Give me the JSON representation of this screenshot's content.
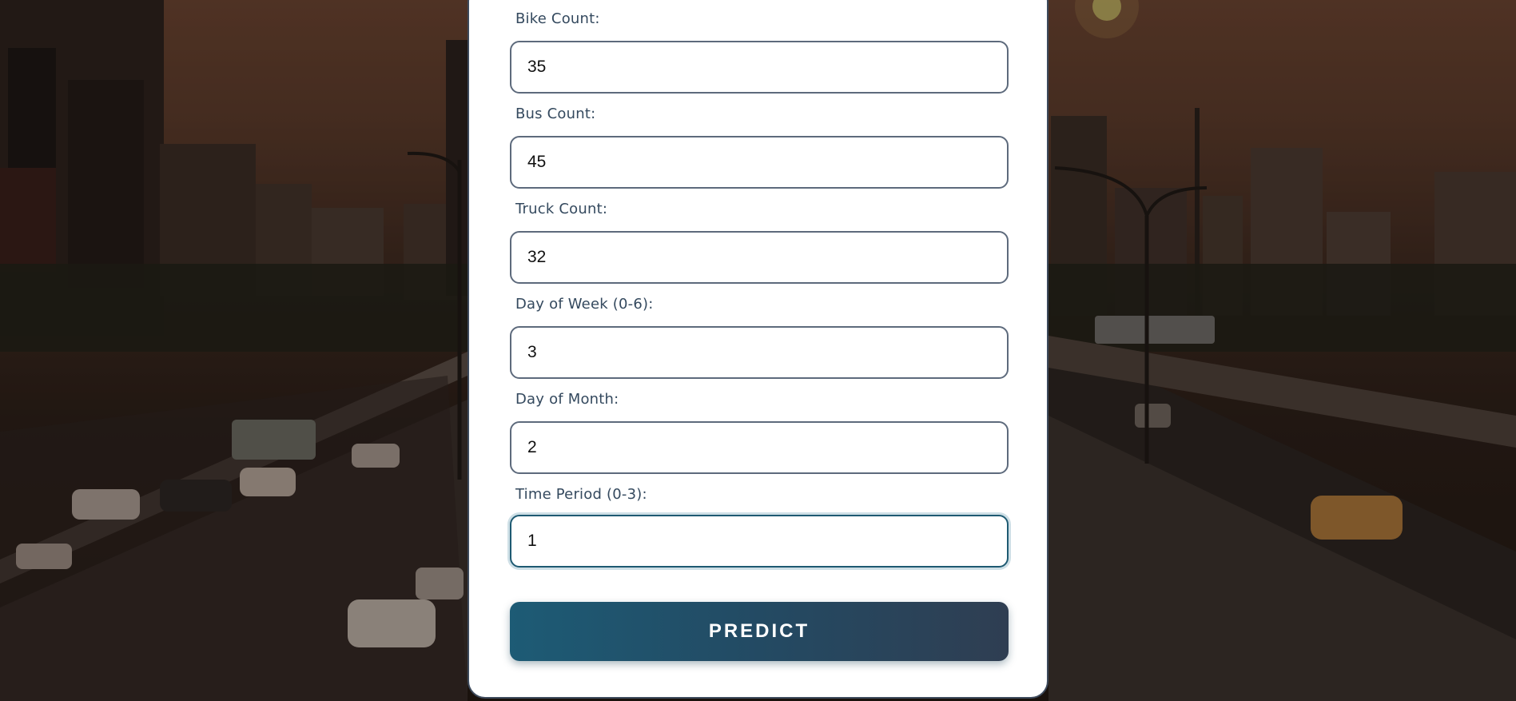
{
  "form": {
    "fields": [
      {
        "label": "Bike Count:",
        "value": "35"
      },
      {
        "label": "Bus Count:",
        "value": "45"
      },
      {
        "label": "Truck Count:",
        "value": "32"
      },
      {
        "label": "Day of Week (0-6):",
        "value": "3"
      },
      {
        "label": "Day of Month:",
        "value": "2"
      },
      {
        "label": "Time Period (0-3):",
        "value": "1"
      }
    ],
    "focused_field": "Time Period (0-3):",
    "submit_label": "PREDICT"
  },
  "colors": {
    "button_gradient_start": "#1d5b75",
    "button_gradient_end": "#2f3e52",
    "label_text": "#34495e",
    "input_border": "#5d6a7c",
    "card_border": "#3d4a5c"
  },
  "background": {
    "icon": "city-traffic-photo"
  }
}
